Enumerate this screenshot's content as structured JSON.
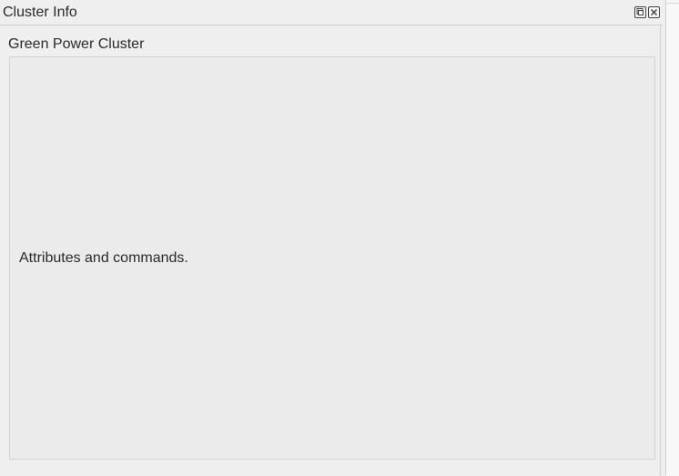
{
  "window": {
    "title": "Cluster Info",
    "buttons": [
      {
        "icon": "float-icon"
      },
      {
        "icon": "close-icon"
      }
    ]
  },
  "cluster": {
    "name": "Green Power Cluster",
    "description": "Attributes and commands."
  }
}
